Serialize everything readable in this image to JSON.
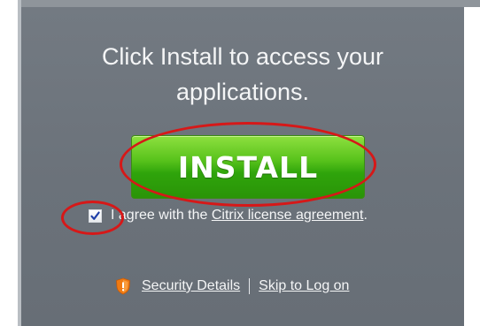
{
  "headline": {
    "line1": "Click Install to access your",
    "line2": "applications."
  },
  "install_button": {
    "label": "INSTALL"
  },
  "agreement": {
    "checked": true,
    "text_before": "I agree with the ",
    "link_text": "Citrix license agreement",
    "text_after": "."
  },
  "footer": {
    "security_details": "Security Details",
    "skip_link": "Skip to Log on"
  },
  "colors": {
    "panel": "#6d747c",
    "button_green": "#2fa40b",
    "annotation_red": "#d61818",
    "checkbox_check": "#1f3fa8",
    "shield_orange": "#f07a12"
  },
  "icons": {
    "checkbox": "checkmark-icon",
    "security": "shield-icon"
  }
}
